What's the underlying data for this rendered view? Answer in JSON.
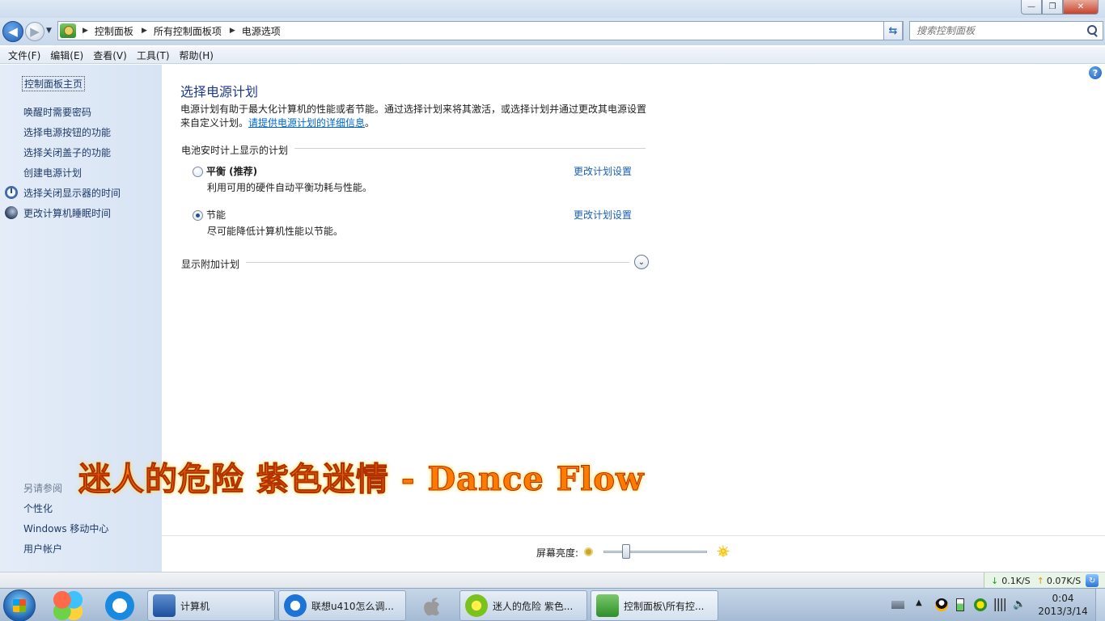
{
  "window": {
    "minimize_glyph": "—",
    "maximize_glyph": "❐",
    "close_glyph": "✕"
  },
  "address": {
    "back_glyph": "◀",
    "forward_glyph": "▶",
    "breadcrumb": [
      "控制面板",
      "所有控制面板项",
      "电源选项"
    ],
    "refresh_glyph": "⇆",
    "search_placeholder": "搜索控制面板"
  },
  "menu": [
    "文件(F)",
    "编辑(E)",
    "查看(V)",
    "工具(T)",
    "帮助(H)"
  ],
  "sidebar": {
    "home": "控制面板主页",
    "links": [
      "唤醒时需要密码",
      "选择电源按钮的功能",
      "选择关闭盖子的功能",
      "创建电源计划",
      "选择关闭显示器的时间",
      "更改计算机睡眠时间"
    ],
    "see_also_title": "另请参阅",
    "see_also": [
      "个性化",
      "Windows 移动中心",
      "用户帐户"
    ]
  },
  "main": {
    "help_glyph": "?",
    "title": "选择电源计划",
    "description_line1": "电源计划有助于最大化计算机的性能或者节能。通过选择计划来将其激活，或选择计划并通过更改其电源设置",
    "description_line2": "来自定义计划。",
    "description_link": "请提供电源计划的详细信息",
    "description_end": "。",
    "group_label": "电池安时计上显示的计划",
    "plans": [
      {
        "name": "平衡 (推荐)",
        "desc": "利用可用的硬件自动平衡功耗与性能。",
        "change": "更改计划设置",
        "selected": false
      },
      {
        "name": "节能",
        "desc": "尽可能降低计算机性能以节能。",
        "change": "更改计划设置",
        "selected": true
      }
    ],
    "extra_label": "显示附加计划",
    "expand_glyph": "⌄"
  },
  "overlay_lyric": "迷人的危险 紫色迷情 - Dance Flow",
  "brightness": {
    "label": "屏幕亮度:",
    "level": 0.22
  },
  "netspeed": {
    "down_glyph": "↓",
    "down": "0.1K/S",
    "up_glyph": "↑",
    "up": "0.07K/S",
    "refresh_glyph": "↻"
  },
  "taskbar": {
    "tasks": [
      "计算机",
      "联想u410怎么调...",
      "迷人的危险 紫色...",
      "控制面板\\所有控..."
    ],
    "clock_time": "0:04",
    "clock_date": "2013/3/14"
  }
}
